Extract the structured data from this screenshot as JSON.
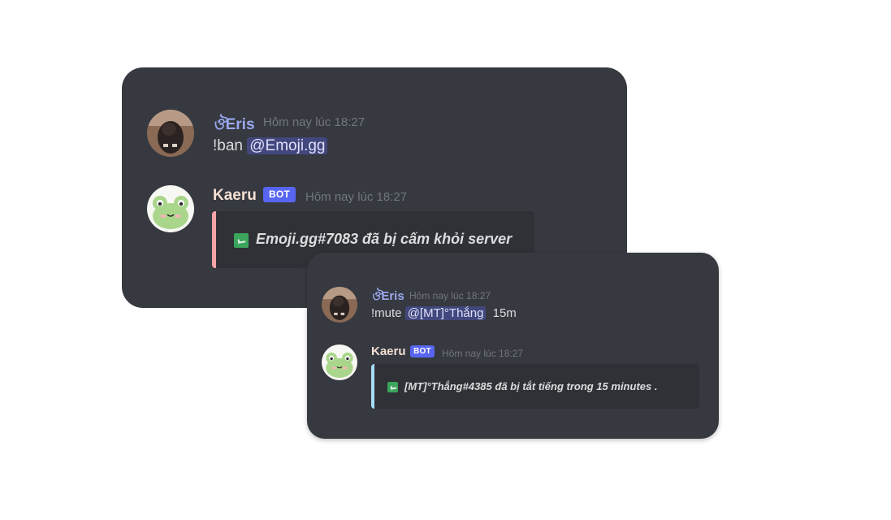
{
  "colors": {
    "card_bg": "#36393f",
    "embed_bg": "#2f3136",
    "bot_badge": "#5865f2",
    "ban_embed_bar": "#f4a3a8",
    "mute_embed_bar": "#a6dcf5",
    "mention_bg": "#4a5596",
    "username_eris": "#9aa8f0",
    "username_kaeru": "#f3dfd2",
    "timestamp": "#72767d"
  },
  "ban_card": {
    "command_message": {
      "avatar": "user-avatar-dark-photo",
      "username_prefix": "ঔ",
      "username": "Eris",
      "timestamp": "Hôm nay lúc 18:27",
      "command": "!ban",
      "mention": "@Emoji.gg"
    },
    "bot_message": {
      "avatar": "frog-avatar-icon",
      "username": "Kaeru",
      "badge": "BOT",
      "timestamp": "Hôm nay lúc 18:27",
      "embed_icon": "green-check-emoji",
      "embed_text": "Emoji.gg#7083 đã bị cấm khỏi server"
    }
  },
  "mute_card": {
    "command_message": {
      "avatar": "user-avatar-dark-photo",
      "username_prefix": "ঔ",
      "username": "Eris",
      "timestamp": "Hôm nay lúc 18:27",
      "command": "!mute",
      "mention": "@[MT]°Thắng",
      "duration": "15m"
    },
    "bot_message": {
      "avatar": "frog-avatar-icon",
      "username": "Kaeru",
      "badge": "BOT",
      "timestamp": "Hôm nay lúc 18:27",
      "embed_icon": "green-check-emoji",
      "embed_text": "[MT]°Thắng#4385 đã bị tắt tiếng trong 15 minutes ."
    }
  }
}
